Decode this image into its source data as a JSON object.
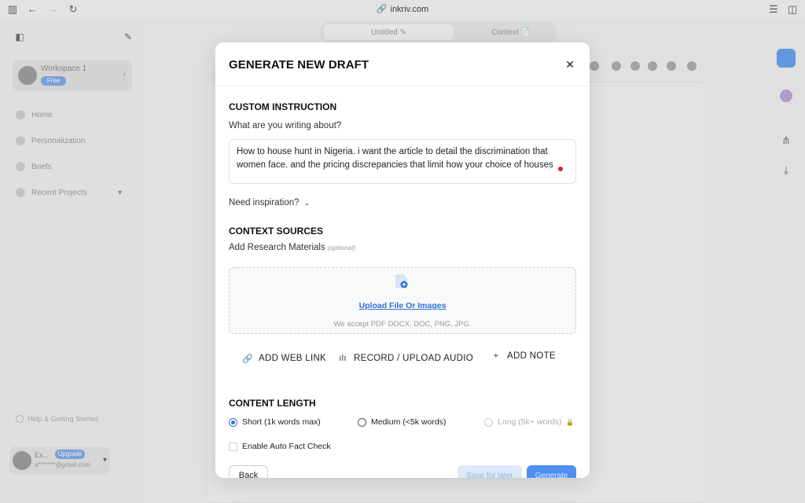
{
  "browser": {
    "url": "inkriv.com"
  },
  "app": {
    "workspace": {
      "name": "Workspace 1",
      "badge": "Free"
    },
    "nav": [
      {
        "label": "Home"
      },
      {
        "label": "Personalization"
      },
      {
        "label": "Briefs"
      },
      {
        "label": "Recent Projects"
      }
    ],
    "help_label": "Help & Getting Started",
    "user": {
      "name": "Ex...",
      "email": "a*******@gmail.com",
      "badge": "Upgrade"
    },
    "tabs": [
      {
        "label": "Untitled ✎"
      },
      {
        "label": "Context 📄"
      }
    ]
  },
  "modal": {
    "title": "GENERATE NEW DRAFT",
    "custom_instruction": {
      "heading": "CUSTOM INSTRUCTION",
      "question": "What are you writing about?",
      "value": "How to house hunt in Nigeria. i want the article to detail the discrimination that women face. and the pricing discrepancies that limit how your choice of houses"
    },
    "inspiration_label": "Need inspiration?",
    "context_sources": {
      "heading": "CONTEXT SOURCES",
      "label": "Add Research Materials",
      "optional": "(optional)",
      "upload_link": "Upload File Or Images",
      "accepted": "We accept PDF DOCX, DOC, PNG, JPG."
    },
    "actions": [
      {
        "label": "ADD WEB LINK",
        "icon": "link-icon"
      },
      {
        "label": "RECORD / UPLOAD AUDIO",
        "icon": "audio-waveform-icon"
      },
      {
        "label": "ADD NOTE",
        "icon": "plus-icon"
      }
    ],
    "content_length": {
      "heading": "CONTENT LENGTH",
      "options": [
        {
          "label": "Short (1k words max)",
          "selected": true,
          "disabled": false
        },
        {
          "label": "Medium (<5k words)",
          "selected": false,
          "disabled": false
        },
        {
          "label": "Long (5k+ words)",
          "selected": false,
          "disabled": true
        }
      ]
    },
    "fact_check_label": "Enable Auto Fact Check",
    "buttons": {
      "back": "Back",
      "save_later": "Save for later",
      "generate": "Generate"
    },
    "colors": {
      "accent": "#2f6fd6",
      "primary_button": "#4f8ff0",
      "recording_dot": "#e0241b"
    }
  }
}
